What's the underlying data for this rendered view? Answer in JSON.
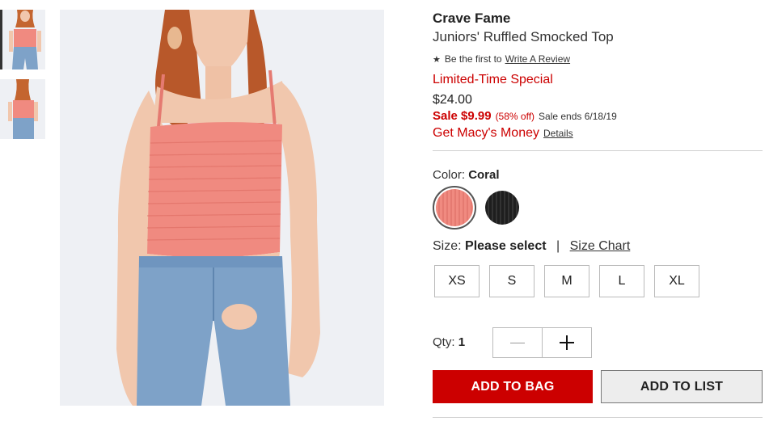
{
  "gallery": {
    "thumbnails": [
      {
        "icon": "product-thumbnail-front"
      },
      {
        "icon": "product-thumbnail-side"
      }
    ],
    "main_image": {
      "icon": "product-main-photo"
    }
  },
  "product": {
    "brand": "Crave Fame",
    "name": "Juniors' Ruffled Smocked Top",
    "review_prefix": "Be the first to",
    "review_link": "Write A Review",
    "promo_label": "Limited-Time Special",
    "original_price": "$24.00",
    "sale_price": "Sale $9.99",
    "discount": "(58% off)",
    "sale_ends": "Sale ends 6/18/19",
    "macys_money": "Get Macy's Money",
    "details_link": "Details"
  },
  "color": {
    "label": "Color:",
    "selected": "Coral",
    "swatches": [
      {
        "name": "Coral",
        "hex": "#f08a80"
      },
      {
        "name": "Black",
        "hex": "#1e1e1e"
      }
    ]
  },
  "size": {
    "label": "Size:",
    "selected": "Please select",
    "separator": "|",
    "chart_link": "Size Chart",
    "options": [
      "XS",
      "S",
      "M",
      "L",
      "XL"
    ]
  },
  "quantity": {
    "label": "Qty:",
    "value": "1"
  },
  "actions": {
    "add_to_bag": "ADD TO BAG",
    "add_to_list": "ADD TO LIST"
  },
  "colors": {
    "accent_red": "#cc0000",
    "button_gray": "#ededed",
    "image_bg": "#eef0f4"
  }
}
